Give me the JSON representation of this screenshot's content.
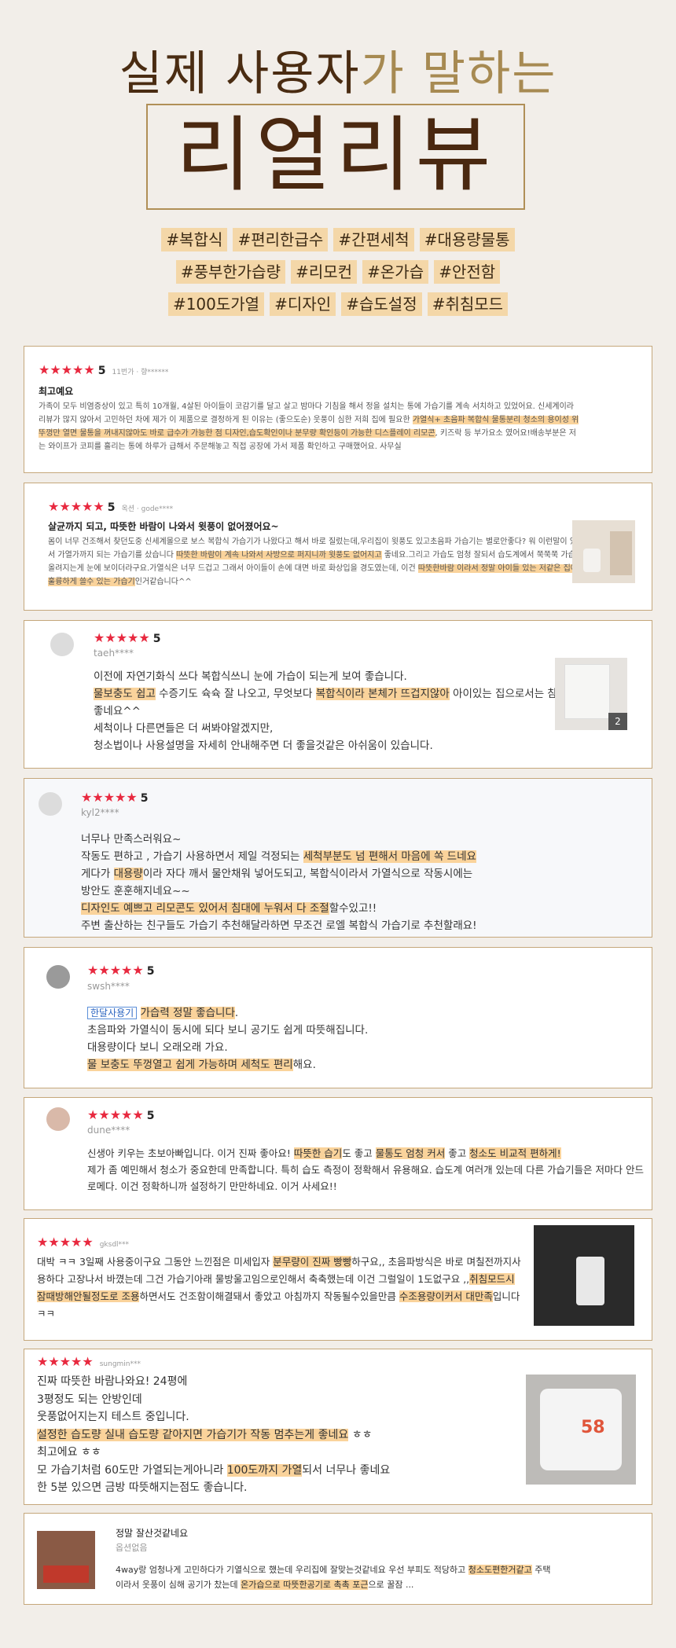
{
  "hero": {
    "line1_dark": "실제 사용자",
    "line1_light": "가 말하는",
    "line2": "리얼리뷰",
    "tag_rows": [
      [
        "#복합식",
        "#편리한급수",
        "#간편세척",
        "#대용량물통"
      ],
      [
        "#풍부한가습량",
        "#리모컨",
        "#온가습",
        "#안전함"
      ],
      [
        "#100도가열",
        "#디자인",
        "#습도설정",
        "#취침모드"
      ]
    ]
  },
  "reviews": [
    {
      "stars": "★★★★★",
      "score": "5",
      "meta": "11번가 · 향******",
      "title": "최고예요",
      "text_a": "가족이 모두 비염증상이 있고 특히 10개월, 4살된 아이들이 코감기를 달고 살고 밤마다 기침을 해서 정을 설치는 통에 가습기를 계속 서치하고 있었어요. 신세계이라 리뷰가 많지 않아서 고민하던 차에 제가 이 제품으로 결정하게 된 이유는 (좋으도순) 웃풍이 심한 저희 집에 필요한 ",
      "hl_1": "가열식+ 초음파 복합식 물통분리 청소의 용이성 위 뚜껑만 열면 물통을 꺼내지않아도 바로 급수가 가능한 점 디자인,습도확인이나 분무량 확인등이 가능한 디스플레이 리모콘",
      "text_b": ", 키즈락 등 부가요소 였어요!배송부분은 저는 와이프가 코피를 흘리는 통에 하루가 급해서 주문해놓고 직접 공장에 가서 제품 확인하고 구매했어요. 사무실"
    },
    {
      "stars": "★★★★★",
      "score": "5",
      "meta": "옥션 · gode****",
      "title": "살균까지 되고, 따뜻한 바람이 나와서 윗풍이 없어졌어요~",
      "text_a": "몸이 너무 건조해서 찾던도중 신세계몰으로 보스 복합식 가습기가 나왔다고 해서 바로 질렀는데,우리집이 윗풍도 있고초음파 가습기는 별로안좋다? 워 이런말이 있어서 가열가까지 되는 가습기를 샀습니다 ",
      "hl_1": "따뜻한 바람이 계속 나와서 사방으로 퍼지니까 윗풍도 없어지고",
      "text_b": " 좋네요.그리고 가습도 엄청 잘되서 습도계에서 쭉쭉쭉 가습이 올려지는게 눈에 보이더라구요.가열식은 너무 드겁고 그래서 아이들이 손에 대면 바로 화상입을 경도였는데, 이건 ",
      "hl_2": "따뜻한바람 이라서 정말 아이들 있는 저같은 집에서 훌륭하게 쓸수 있는 가습기",
      "text_c": "인거같습니다^^"
    },
    {
      "stars": "★★★★★",
      "score": "5",
      "user": "taeh****",
      "line1": "이전에 자연기화식 쓰다 복합식쓰니 눈에 가습이 되는게 보여 좋습니다.",
      "hl_1": "물보충도 쉽고",
      "text_a": " 수증기도 슉슉 잘 나오고, 무엇보다 ",
      "hl_2": "복합식이라 본체가 뜨겁지않아",
      "text_b": " 아이있는 집으로서는 참 좋네요^^",
      "line3": "세척이나 다른면들은 더 써봐야알겠지만,",
      "line4": "청소법이나 사용설명을 자세히 안내해주면 더 좋을것같은 아쉬움이 있습니다.",
      "badge": "2"
    },
    {
      "stars": "★★★★★",
      "score": "5",
      "user": "kyl2****",
      "line1": "너무나 만족스러워요~",
      "text_a": "작동도 편하고 , 가습기 사용하면서 제일 걱정되는 ",
      "hl_1": "세척부분도 넘 편해서 마음에 쏙 드네요",
      "text_b": "게다가 ",
      "hl_2": "대용량",
      "text_c": "이라 자다 깨서 물안채워 넣어도되고, 복합식이라서 가열식으로 작동시에는",
      "line4": "방안도 훈훈해지네요~~",
      "hl_3": "디자인도 예쁘고 리모콘도 있어서 침대에 누워서 다 조절",
      "text_d": "할수있고!!",
      "line6": "주변 출산하는 친구들도 가습기 추천해달라하면 무조건 로엘 복합식 가습기로 추천할래요!"
    },
    {
      "stars": "★★★★★",
      "score": "5",
      "user": "swsh****",
      "tag": "한달사용기",
      "hl_1": "가습력 정말 좋습니다",
      "text_a": ".",
      "line2": "초음파와 가열식이 동시에 되다 보니 공기도 쉽게 따뜻해집니다.",
      "line3": "대용량이다 보니 오래오래 가요.",
      "hl_2": "물 보충도 뚜껑열고 쉽게 가능하며 세척도 편리",
      "text_b": "해요."
    },
    {
      "stars": "★★★★★",
      "score": "5",
      "user": "dune****",
      "text_a": "신생아 키우는 초보아빠입니다. 이거 진짜 좋아요! ",
      "hl_1": "따뜻한 습기",
      "text_b": "도 좋고 ",
      "hl_2": "물통도 엄청 커서",
      "text_c": " 좋고 ",
      "hl_3": "청소도 비교적 편하게!",
      "line2": "제가 좀 예민해서 청소가 중요한데 만족합니다. 특히 습도 측정이 정확해서 유용해요. 습도계 여러개 있는데 다른 가습기들은 저마다 안드로메다. 이건 정확하니까 설정하기 만만하네요. 이거 사세요!!"
    },
    {
      "stars": "★★★★★",
      "user": "gksdl***",
      "text_a": "대박 ㅋㅋ 3일째 사용중이구요 그동안 느낀점은 미세입자 ",
      "hl_1": "분무량이 진짜 빵빵",
      "text_b": "하구요,, 초음파방식은 바로 며칠전까지사용하다 고장나서 바꼈는데 그건 가습기아래 물방울고임으로인해서 축축했는데 이건 그럴일이 1도없구요 ,,",
      "hl_2": "취침모드시 잠때방해안될정도로 조용",
      "text_c": "하면서도 건조함이해결돼서 좋았고 아침까지 작동될수있을만큼 ",
      "hl_3": "수조용량이커서 대만족",
      "text_d": "입니다 ㅋㅋ"
    },
    {
      "stars": "★★★★★",
      "user": "sungmin***",
      "line1": "진짜 따뜻한 바람나와요! 24평에",
      "line2": "3평정도 되는 안방인데",
      "line3": "웃풍없어지는지 테스트 중입니다.",
      "hl_1": "설정한 습도량 실내 습도량 같아지면 가습기가 작동 멈추는게 좋네요",
      "text_a": " ㅎㅎ",
      "line5": "최고에요 ㅎㅎ",
      "text_b": "모 가습기처럼 60도만 가열되는게아니라 ",
      "hl_2": "100도까지 가열",
      "text_c": "되서 너무나 좋네요",
      "line7": "한 5분 있으면 금방 따뜻해지는점도 좋습니다.",
      "display": "58"
    },
    {
      "title": "정말 잘산것같네요",
      "option": "옵션없음",
      "text_a": "4way랑 엄청나게 고민하다가 기열식으로 했는데 우리집에 잘맞는것같네요 우선 부피도 적당하고 ",
      "hl_1": "청소도편한거같고",
      "text_b": " 주택이라서 웃풍이 심해 공기가 찼는데 ",
      "hl_2": "온가습으로 따뜻한공기로 촉촉 포근",
      "text_c": "으로 꿀잠 ..."
    }
  ]
}
